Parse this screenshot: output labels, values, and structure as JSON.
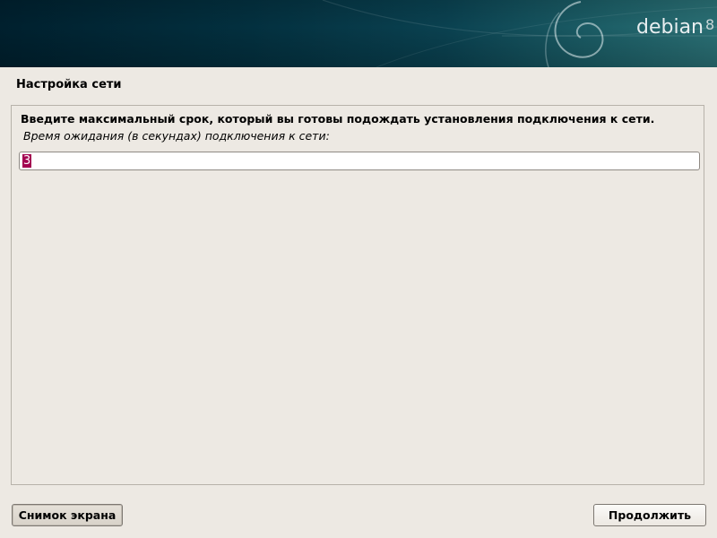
{
  "header": {
    "logo_text": "debian",
    "logo_version": "8"
  },
  "page": {
    "title": "Настройка сети"
  },
  "question": {
    "text": "Введите максимальный срок, который вы готовы подождать установления подключения к сети.",
    "field_label": "Время ожидания (в секундах) подключения к сети:",
    "field_value": "3"
  },
  "buttons": {
    "screenshot_label": "Снимок экрана",
    "continue_label": "Продолжить"
  },
  "colors": {
    "selection": "#a30050",
    "banner_dark": "#00202e",
    "banner_light": "#2a6f74"
  }
}
